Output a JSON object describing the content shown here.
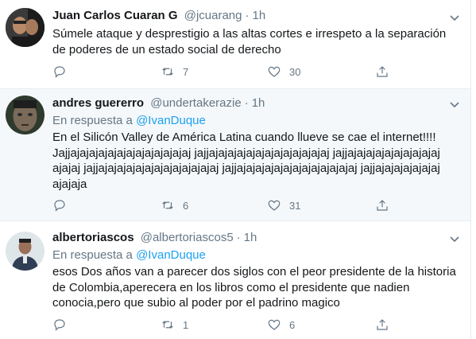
{
  "tweets": [
    {
      "name": "Juan Carlos Cuaran G",
      "handle": "@jcuarang",
      "time": "1h",
      "reply_prefix": "",
      "reply_mention": "",
      "text": "Súmele ataque y desprestigio a las altas cortes e irrespeto a la separación de poderes de un estado social de derecho",
      "retweets": "7",
      "likes": "30"
    },
    {
      "name": "andres guererro",
      "handle": "@undertakerazie",
      "time": "1h",
      "reply_prefix": "En respuesta a ",
      "reply_mention": "@IvanDuque",
      "text": "En el Silicón Valley de América Latina cuando llueve se cae el internet!!!! Jajjajajajajajajajajajajajajaj jajjajajajajajajajajajajajajaj jajjajajajajajajajajajajajajaj jajjajajajajajajajajajajajajaj jajjajajajajajajajajajajajajaj jajjajajajajajajajajajaja",
      "retweets": "6",
      "likes": "31"
    },
    {
      "name": "albertoriascos",
      "handle": "@albertoriascos5",
      "time": "1h",
      "reply_prefix": "En respuesta a ",
      "reply_mention": "@IvanDuque",
      "text": "esos Dos años van a parecer dos siglos con el peor presidente de la historia de Colombia,aperecera en los libros como el presidente que nadien conocia,pero que subio al poder por el padrino magico",
      "retweets": "1",
      "likes": "6"
    }
  ],
  "dot": "·",
  "icons": [
    "reply-icon",
    "retweet-icon",
    "like-icon",
    "share-icon",
    "chevron-down-icon"
  ],
  "colors": {
    "accent": "#1da1f2",
    "muted": "#657786",
    "text": "#14171a",
    "highlight_bg": "#f5f8fa",
    "border": "#e6ecf0"
  }
}
